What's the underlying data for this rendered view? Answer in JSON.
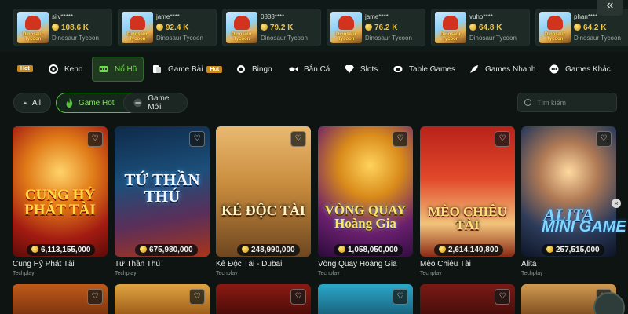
{
  "winners": [
    {
      "user": "silv*****",
      "amount": "108.6 K",
      "game": "Dinosaur Tycoon"
    },
    {
      "user": "jame****",
      "amount": "92.4 K",
      "game": "Dinosaur Tycoon"
    },
    {
      "user": "0888****",
      "amount": "79.2 K",
      "game": "Dinosaur Tycoon"
    },
    {
      "user": "jame****",
      "amount": "76.2 K",
      "game": "Dinosaur Tycoon"
    },
    {
      "user": "vuho****",
      "amount": "64.8 K",
      "game": "Dinosaur Tycoon"
    },
    {
      "user": "phan****",
      "amount": "64.2 K",
      "game": "Dinosaur Tycoon"
    }
  ],
  "thumb_text": "Dinosaur Tycoon",
  "collapse_icon": "«",
  "nav": {
    "hot_badge": "Hot",
    "items": [
      {
        "label": "Keno",
        "icon": "keno-icon"
      },
      {
        "label": "Nổ Hũ",
        "icon": "slot-machine-icon",
        "active": true
      },
      {
        "label": "Game Bài",
        "icon": "cards-icon",
        "badge": "Hot"
      },
      {
        "label": "Bingo",
        "icon": "bingo-icon"
      },
      {
        "label": "Bắn Cá",
        "icon": "fish-icon"
      },
      {
        "label": "Slots",
        "icon": "diamond-icon"
      },
      {
        "label": "Table Games",
        "icon": "table-icon"
      },
      {
        "label": "Games Nhanh",
        "icon": "rocket-icon"
      },
      {
        "label": "Games Khác",
        "icon": "other-games-icon"
      }
    ]
  },
  "filters": {
    "all": "All",
    "hot": "Game Hot",
    "new": "Game Mới",
    "active": "Game Hot"
  },
  "search": {
    "placeholder": "Tìm kiếm"
  },
  "games": [
    {
      "name": "Cung Hỷ Phát Tài",
      "provider": "Techplay",
      "jackpot": "6,113,155,000",
      "art_text": "CUNG HỶ PHÁT TÀI"
    },
    {
      "name": "Tứ Thần Thú",
      "provider": "Techplay",
      "jackpot": "675,980,000",
      "art_text": "TỨ THẦN THÚ"
    },
    {
      "name": "Kẻ Độc Tài - Dubai",
      "provider": "Techplay",
      "jackpot": "248,990,000",
      "art_text": "KẺ ĐỘC TÀI"
    },
    {
      "name": "Vòng Quay Hoàng Gia",
      "provider": "Techplay",
      "jackpot": "1,058,050,000",
      "art_text": "VÒNG QUAY Hoàng Gia"
    },
    {
      "name": "Mèo Chiêu Tài",
      "provider": "Techplay",
      "jackpot": "2,614,140,800",
      "art_text": "MÈO CHIÊU TÀI"
    },
    {
      "name": "Alita",
      "provider": "Techplay",
      "jackpot": "257,515,000",
      "art_text": "ALITA"
    }
  ],
  "mini_game_label": "MINI GAME",
  "close_label": "×",
  "colors": {
    "accent": "#57c23d",
    "background": "#0d1412",
    "gold": "#f4c542",
    "hot_badge": "#c98a1e"
  }
}
